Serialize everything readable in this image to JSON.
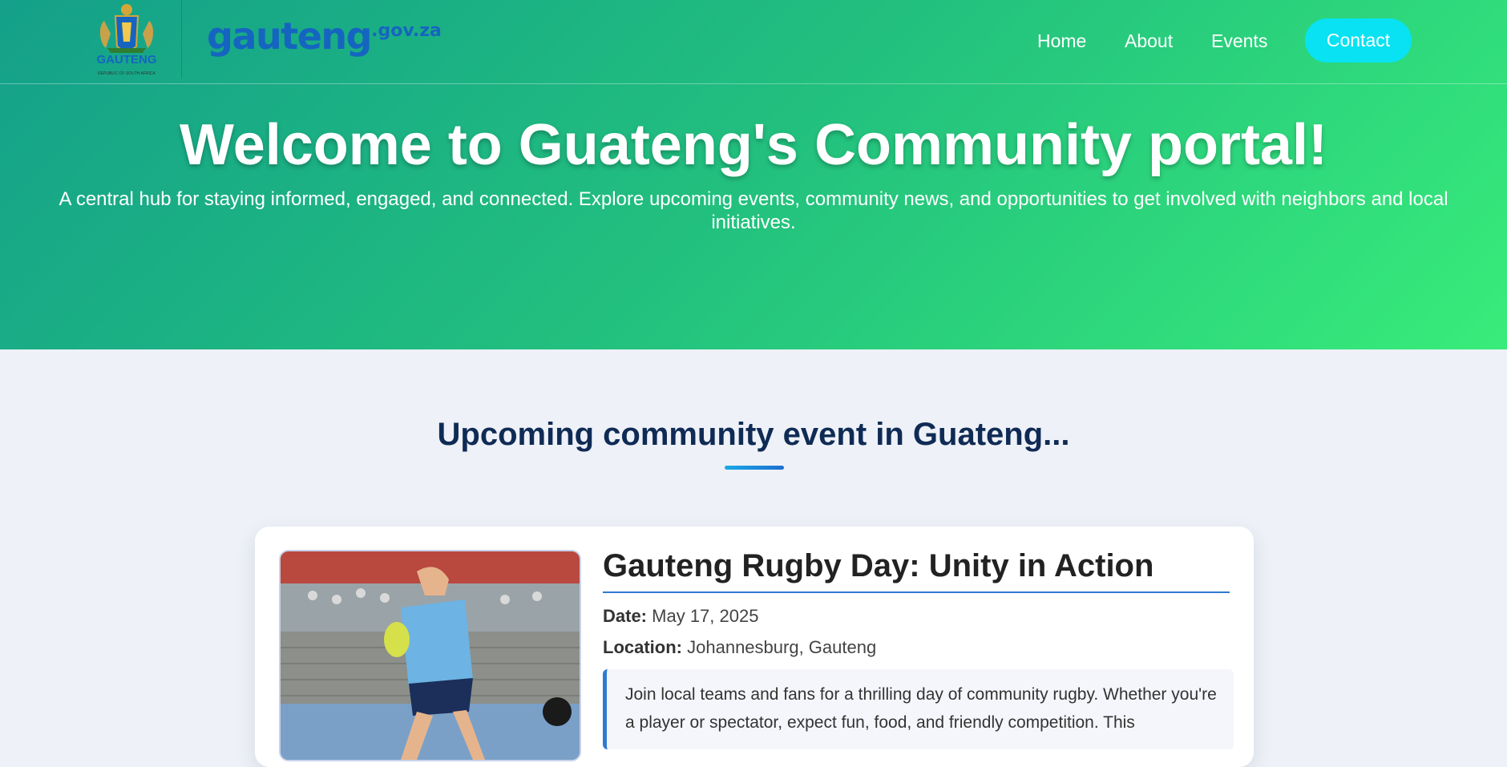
{
  "header": {
    "coat_of_arms_label": "GAUTENG",
    "coat_of_arms_sub": "REPUBLIC OF SOUTH AFRICA",
    "brand_main": "gauteng",
    "brand_domain": ".gov.za",
    "nav": [
      "Home",
      "About",
      "Events"
    ],
    "contact_label": "Contact"
  },
  "hero": {
    "title": "Welcome to Guateng's Community portal!",
    "subtitle": "A central hub for staying informed, engaged, and connected. Explore upcoming events, community news, and opportunities to get involved with neighbors and local initiatives."
  },
  "events": {
    "section_title": "Upcoming community event in Guateng...",
    "card": {
      "title": "Gauteng Rugby Day: Unity in Action",
      "date_label": "Date:",
      "date": "May 17, 2025",
      "location_label": "Location:",
      "location": "Johannesburg, Gauteng",
      "description": "Join local teams and fans for a thrilling day of community rugby. Whether you're a player or spectator, expect fun, food, and friendly competition. This"
    }
  },
  "colors": {
    "hero_gradient_start": "#14a08a",
    "hero_gradient_end": "#38ec7a",
    "contact_button": "#08e2f2",
    "brand_blue": "#1565c0",
    "section_title": "#0f2b55",
    "accent_rule": "#2f7ad0"
  },
  "icons": {
    "coat_of_arms": "gauteng-coat-of-arms-icon"
  }
}
